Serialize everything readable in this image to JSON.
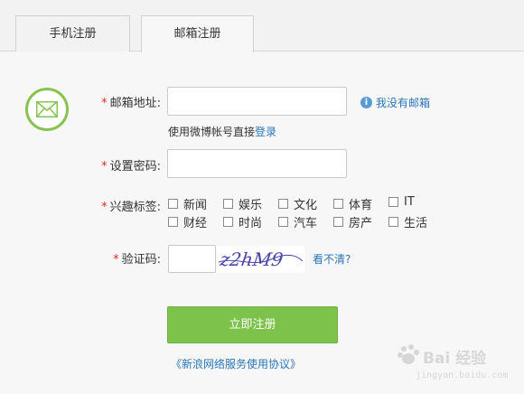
{
  "tabs": [
    {
      "label": "手机注册"
    },
    {
      "label": "邮箱注册"
    }
  ],
  "form": {
    "email_label": "邮箱地址:",
    "email_value": "",
    "no_email_link": "我没有邮箱",
    "hint_prefix": "使用微博帐号直接",
    "hint_login": "登录",
    "password_label": "设置密码:",
    "password_value": "",
    "interests_label": "兴趣标签:",
    "interests": [
      "新闻",
      "娱乐",
      "文化",
      "体育",
      "IT",
      "财经",
      "时尚",
      "汽车",
      "房产",
      "生活"
    ],
    "captcha_label": "验证码:",
    "captcha_value": "",
    "captcha_image_text": "z2hM9",
    "captcha_unclear": "看不清?",
    "submit_label": "立即注册",
    "agreement_link": "《新浪网络服务使用协议》",
    "required_mark": "*"
  },
  "watermark": {
    "text": "Bai 经验",
    "sub": "jingyan.baidu.com"
  },
  "colors": {
    "accent_green": "#7dc24a",
    "link_blue": "#2a76b8",
    "required_red": "#e02828"
  }
}
